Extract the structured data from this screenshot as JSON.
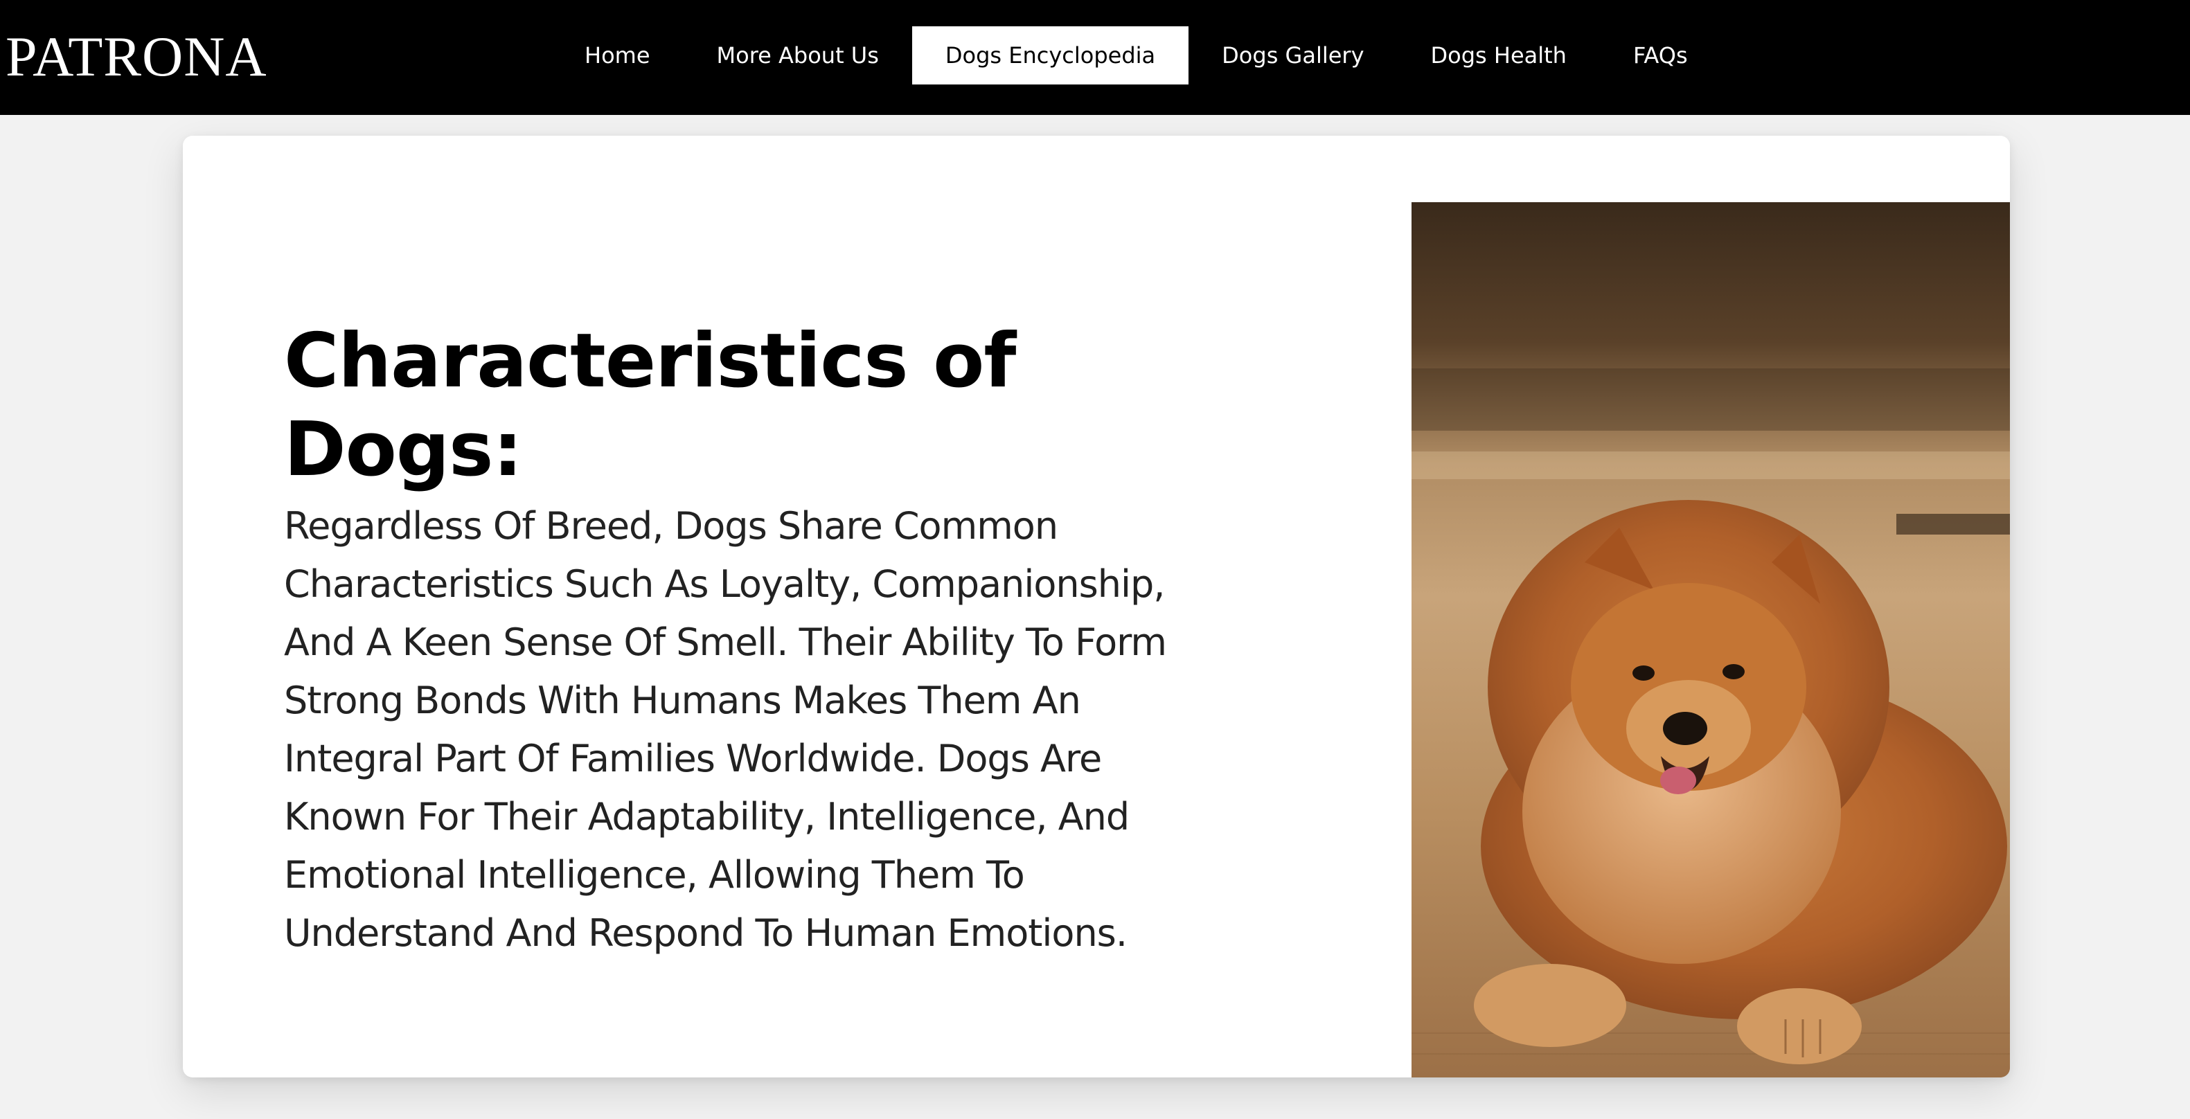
{
  "brand": {
    "logo_text": "PATRONA"
  },
  "nav": {
    "items": [
      {
        "label": "Home"
      },
      {
        "label": "More About Us"
      },
      {
        "label": "Dogs Encyclopedia"
      },
      {
        "label": "Dogs Gallery"
      },
      {
        "label": "Dogs Health"
      },
      {
        "label": "FAQs"
      }
    ],
    "active_index": 2
  },
  "content": {
    "title": "Characteristics of Dogs:",
    "body": "Regardless Of Breed, Dogs Share Common Characteristics Such As Loyalty, Companionship, And A Keen Sense Of Smell. Their Ability To Form Strong Bonds With Humans Makes Them An Integral Part Of Families Worldwide. Dogs Are Known For Their Adaptability, Intelligence, And Emotional Intelligence, Allowing Them To Understand And Respond To Human Emotions."
  },
  "colors": {
    "navbar_background": "#000000",
    "nav_text": "#ffffff",
    "active_tab_background": "#ffffff",
    "active_tab_text": "#000000",
    "page_background": "#f2f2f2",
    "card_background": "#ffffff"
  }
}
